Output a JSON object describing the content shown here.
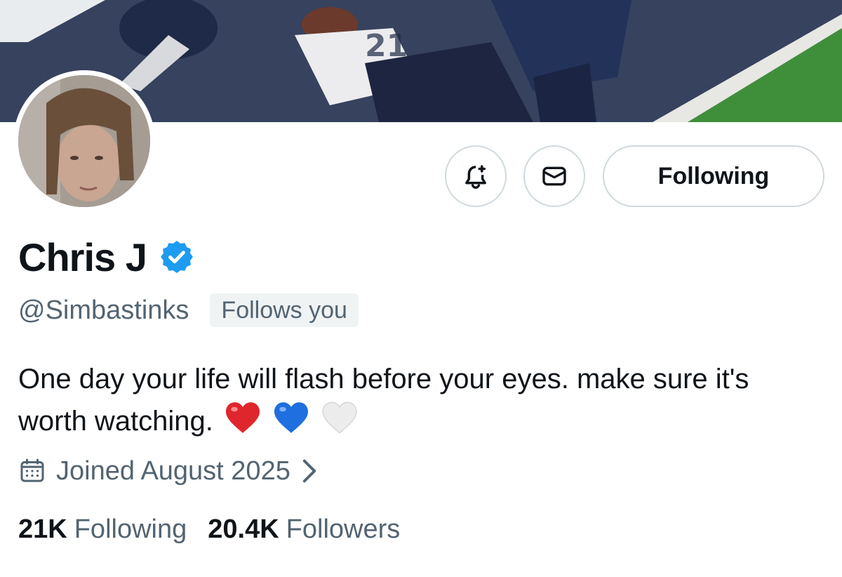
{
  "profile": {
    "display_name": "Chris J",
    "handle": "@Simbastinks",
    "follows_you_label": "Follows you",
    "bio": "One day your life will flash before your eyes. make sure it's worth watching.",
    "bio_emojis": [
      "red-heart",
      "blue-heart",
      "white-heart"
    ],
    "joined": "Joined August 2025",
    "verified": true
  },
  "actions": {
    "follow_state_label": "Following",
    "notify_icon": "bell-plus-icon",
    "message_icon": "envelope-icon"
  },
  "stats": {
    "following_count": "21K",
    "following_label": "Following",
    "followers_count": "20.4K",
    "followers_label": "Followers"
  },
  "colors": {
    "verified_blue": "#1d9bf0",
    "secondary_text": "#536471",
    "border": "#cfd9de"
  }
}
